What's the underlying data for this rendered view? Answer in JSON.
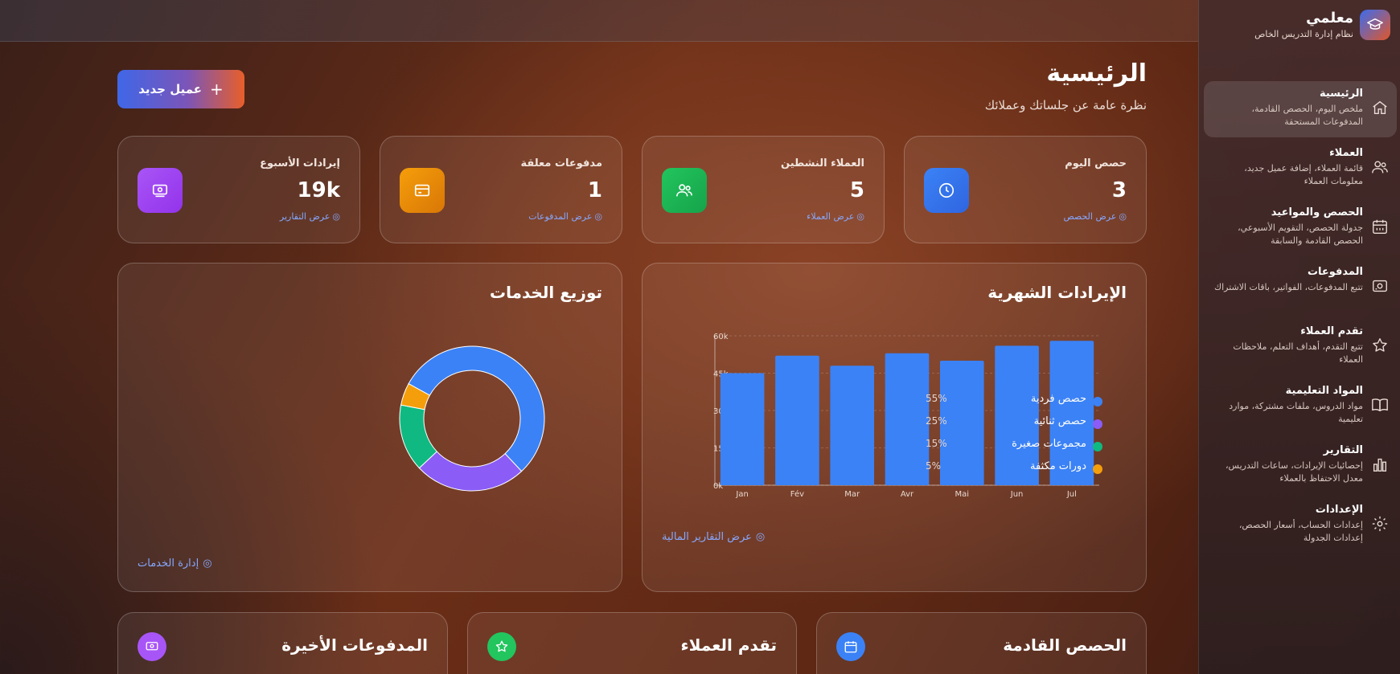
{
  "brand": {
    "name": "معلمي",
    "subtitle": "نظام إدارة التدريس الخاص"
  },
  "sidebar": {
    "items": [
      {
        "title": "الرئيسية",
        "desc": "ملخص اليوم، الحصص القادمة، المدفوعات المستحقة",
        "icon": "home-icon",
        "active": true
      },
      {
        "title": "العملاء",
        "desc": "قائمة العملاء، إضافة عميل جديد، معلومات العملاء",
        "icon": "users-icon"
      },
      {
        "title": "الحصص والمواعيد",
        "desc": "جدولة الحصص، التقويم الأسبوعي، الحصص القادمة والسابقة",
        "icon": "calendar-icon"
      },
      {
        "title": "المدفوعات",
        "desc": "تتبع المدفوعات، الفواتير، باقات الاشتراك",
        "icon": "wallet-icon"
      },
      {
        "title": "تقدم العملاء",
        "desc": "تتبع التقدم، أهداف التعلم، ملاحظات العملاء",
        "icon": "star-icon"
      },
      {
        "title": "المواد التعليمية",
        "desc": "مواد الدروس، ملفات مشتركة، موارد تعليمية",
        "icon": "book-icon"
      },
      {
        "title": "التقارير",
        "desc": "إحصائيات الإيرادات، ساعات التدريس، معدل الاحتفاظ بالعملاء",
        "icon": "bar-chart-icon"
      },
      {
        "title": "الإعدادات",
        "desc": "إعدادات الحساب، أسعار الحصص، إعدادات الجدولة",
        "icon": "gear-icon"
      }
    ]
  },
  "header": {
    "title": "الرئيسية",
    "subtitle": "نظرة عامة عن جلساتك وعملائك",
    "new_client_label": "عميل جديد"
  },
  "stats": [
    {
      "label": "حصص اليوم",
      "value": "3",
      "link": "عرض الحصص",
      "icon": "clock-icon",
      "color": "#3b82f6"
    },
    {
      "label": "العملاء النشطين",
      "value": "5",
      "link": "عرض العملاء",
      "icon": "users-icon",
      "color": "#22c55e"
    },
    {
      "label": "مدفوعات معلقة",
      "value": "1",
      "link": "عرض المدفوعات",
      "icon": "card-icon",
      "color": "#f59e0b"
    },
    {
      "label": "إيرادات الأسبوع",
      "value": "19k",
      "link": "عرض التقارير",
      "icon": "money-icon",
      "color": "#a855f7"
    }
  ],
  "revenue_panel": {
    "title": "الإيرادات الشهرية",
    "link": "عرض التقارير المالية"
  },
  "services_panel": {
    "title": "توزيع الخدمات",
    "link": "إدارة الخدمات"
  },
  "chart_data": [
    {
      "type": "bar",
      "title": "الإيرادات الشهرية",
      "categories": [
        "Jan",
        "Fév",
        "Mar",
        "Avr",
        "Mai",
        "Jun",
        "Jul"
      ],
      "values": [
        45000,
        52000,
        48000,
        53000,
        50000,
        56000,
        58000
      ],
      "ytick_labels": [
        "0k",
        "15k",
        "30k",
        "45k",
        "60k"
      ],
      "ylim": [
        0,
        60000
      ],
      "grid": true,
      "color": "#3b82f6"
    },
    {
      "type": "pie",
      "title": "توزيع الخدمات",
      "donut": true,
      "labels": [
        "حصص فردية",
        "حصص ثنائية",
        "مجموعات صغيرة",
        "دورات مكثفة"
      ],
      "values": [
        55,
        25,
        15,
        5
      ],
      "value_labels": [
        "55%",
        "25%",
        "15%",
        "5%"
      ],
      "colors": [
        "#3b82f6",
        "#8b5cf6",
        "#10b981",
        "#f59e0b"
      ]
    }
  ],
  "bottom_panels": [
    {
      "title": "الحصص القادمة",
      "icon": "calendar-icon",
      "color": "#3b82f6"
    },
    {
      "title": "تقدم العملاء",
      "icon": "star-icon",
      "color": "#22c55e"
    },
    {
      "title": "المدفوعات الأخيرة",
      "icon": "money-icon",
      "color": "#a855f7"
    }
  ]
}
